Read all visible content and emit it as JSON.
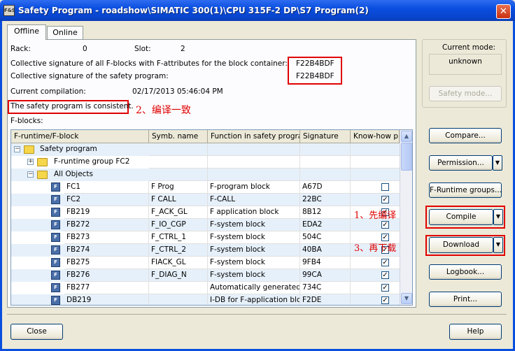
{
  "window": {
    "title": "Safety Program - roadshow\\SIMATIC 300(1)\\CPU 315F-2 DP\\S7 Program(2)",
    "icon_text": "F&S",
    "close_glyph": "✕"
  },
  "tabs": [
    {
      "label": "Offline",
      "selected": true
    },
    {
      "label": "Online",
      "selected": false
    }
  ],
  "info": {
    "rack_label": "Rack:",
    "rack_value": "0",
    "slot_label": "Slot:",
    "slot_value": "2",
    "sig_all_label": "Collective signature of all F-blocks with F-attributes for the block container:",
    "sig_all_value": "F22B4BDF",
    "sig_prog_label": "Collective signature of the safety program:",
    "sig_prog_value": "F22B4BDF",
    "compilation_label": "Current compilation:",
    "compilation_value": "02/17/2013 05:46:04 PM",
    "status_text": "The safety program is consistent.",
    "fblocks_label": "F-blocks:"
  },
  "annotations": {
    "consistent": "2、编译一致",
    "compile": "1、先编译",
    "download": "3、再下载"
  },
  "table": {
    "columns": [
      "F-runtime/F-block",
      "Symb. name",
      "Function in safety program",
      "Signature",
      "Know-how p"
    ],
    "tree": [
      {
        "label": "Safety program",
        "level": 0,
        "expander": "−"
      },
      {
        "label": "F-runtime group FC2",
        "level": 1,
        "expander": "+"
      },
      {
        "label": "All Objects",
        "level": 1,
        "expander": "−"
      }
    ],
    "rows": [
      {
        "block": "FC1",
        "symbol": "F Prog",
        "function": "F-program block",
        "signature": "A67D",
        "knowhow": false
      },
      {
        "block": "FC2",
        "symbol": "F CALL",
        "function": "F-CALL",
        "signature": "22BC",
        "knowhow": true
      },
      {
        "block": "FB219",
        "symbol": "F_ACK_GL",
        "function": "F application block",
        "signature": "8B12",
        "knowhow": true
      },
      {
        "block": "FB272",
        "symbol": "F_IO_CGP",
        "function": "F-system block",
        "signature": "EDA2",
        "knowhow": true
      },
      {
        "block": "FB273",
        "symbol": "F_CTRL_1",
        "function": "F-system block",
        "signature": "504C",
        "knowhow": true
      },
      {
        "block": "FB274",
        "symbol": "F_CTRL_2",
        "function": "F-system block",
        "signature": "40BA",
        "knowhow": true
      },
      {
        "block": "FB275",
        "symbol": "FIACK_GL",
        "function": "F-system block",
        "signature": "9FB4",
        "knowhow": true
      },
      {
        "block": "FB276",
        "symbol": "F_DIAG_N",
        "function": "F-system block",
        "signature": "99CA",
        "knowhow": true
      },
      {
        "block": "FB277",
        "symbol": "",
        "function": "Automatically generated ...",
        "signature": "734C",
        "knowhow": true
      },
      {
        "block": "DB219",
        "symbol": "",
        "function": "I-DB for F-application block",
        "signature": "F2DE",
        "knowhow": true
      }
    ]
  },
  "right_panel": {
    "mode_label": "Current mode:",
    "mode_value": "unknown",
    "safety_mode_button": "Safety mode...",
    "compare_button": "Compare...",
    "permission_button": "Permission...",
    "runtime_groups_button": "F-Runtime groups...",
    "compile_button": "Compile",
    "download_button": "Download",
    "logbook_button": "Logbook...",
    "print_button": "Print..."
  },
  "footer": {
    "close_button": "Close",
    "help_button": "Help"
  },
  "colors": {
    "title_bar": "#0a4ee0",
    "highlight_red": "#e00000",
    "row_alt": "#e6f0fa"
  }
}
